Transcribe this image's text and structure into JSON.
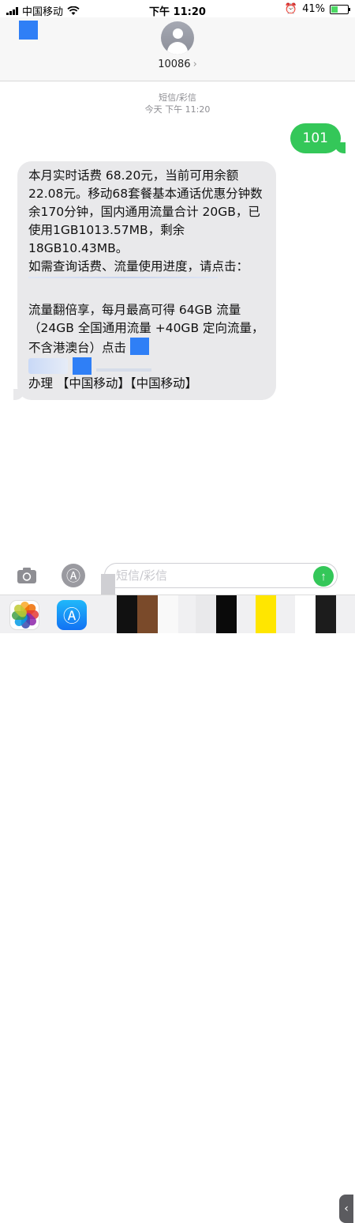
{
  "status_bar": {
    "carrier": "中国移动",
    "time": "下午 11:20",
    "battery": "41%",
    "battery_level": 0.41
  },
  "header": {
    "contact": "10086",
    "chevron": "›",
    "avatar_icon": "person-icon"
  },
  "conversation": {
    "service_label": "短信/彩信",
    "timestamp": "今天 下午 11:20",
    "sent_message": "101",
    "received_paragraphs": [
      "本月实时话费 68.20元，当前可用余额22.08元。移动68套餐基本通话优惠分钟数余170分钟，国内通用流量合计 20GB，已使用1GB1013.57MB，剩余18GB10.43MB。",
      "如需查询话费、流量使用进度，请点击：",
      "流量翻倍享，每月最高可得 64GB 流量（24GB 全国通用流量 +40GB 定向流量，不含港澳台）点击",
      "办理 【中国移动】【中国移动】"
    ]
  },
  "input": {
    "placeholder": "短信/彩信",
    "send_icon": "arrow-up-icon",
    "camera_icon": "camera-icon",
    "appstore_icon": "app-store-icon"
  },
  "drawer": {
    "apps": [
      "photos-icon",
      "app-store-icon"
    ],
    "swatch_colors": [
      "#111111",
      "#7a4a2a",
      "#f9f9f9",
      "#e9e9eb",
      "#0a0a0a",
      "#ffe600",
      "#ffffff",
      "#1c1c1c"
    ],
    "accent_green": "#34c759",
    "bubble_gray": "#e9e9eb"
  }
}
